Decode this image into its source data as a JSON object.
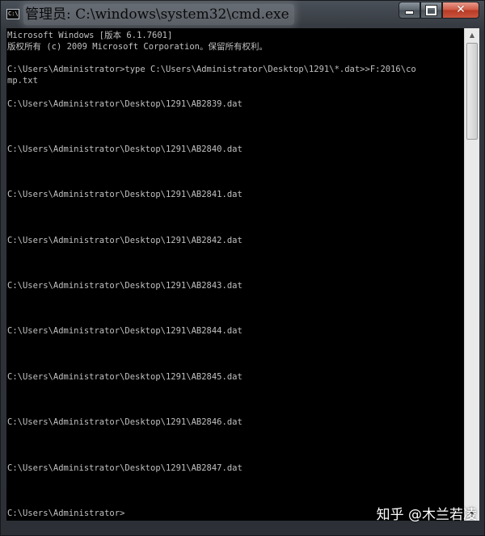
{
  "window": {
    "title": "管理员: C:\\windows\\system32\\cmd.exe",
    "icon": "cmd-icon",
    "icon_glyph": "C:\\",
    "buttons": {
      "minimize": "minimize-icon",
      "maximize": "maximize-icon",
      "close": "close-icon",
      "close_glyph": "✕"
    }
  },
  "console": {
    "lines": [
      "Microsoft Windows [版本 6.1.7601]",
      "版权所有 (c) 2009 Microsoft Corporation。保留所有权利。",
      "",
      "C:\\Users\\Administrator>type C:\\Users\\Administrator\\Desktop\\1291\\*.dat>>F:2016\\co",
      "mp.txt",
      "",
      "C:\\Users\\Administrator\\Desktop\\1291\\AB2839.dat",
      "",
      "",
      "",
      "C:\\Users\\Administrator\\Desktop\\1291\\AB2840.dat",
      "",
      "",
      "",
      "C:\\Users\\Administrator\\Desktop\\1291\\AB2841.dat",
      "",
      "",
      "",
      "C:\\Users\\Administrator\\Desktop\\1291\\AB2842.dat",
      "",
      "",
      "",
      "C:\\Users\\Administrator\\Desktop\\1291\\AB2843.dat",
      "",
      "",
      "",
      "C:\\Users\\Administrator\\Desktop\\1291\\AB2844.dat",
      "",
      "",
      "",
      "C:\\Users\\Administrator\\Desktop\\1291\\AB2845.dat",
      "",
      "",
      "",
      "C:\\Users\\Administrator\\Desktop\\1291\\AB2846.dat",
      "",
      "",
      "",
      "C:\\Users\\Administrator\\Desktop\\1291\\AB2847.dat",
      "",
      "",
      "",
      "C:\\Users\\Administrator>"
    ],
    "text_color": "#c0c0c0",
    "background_color": "#000000"
  },
  "scrollbar": {
    "up_glyph": "▲",
    "down_glyph": "▼",
    "position": 0
  },
  "watermark": {
    "text": "知乎 @木兰若凌"
  }
}
